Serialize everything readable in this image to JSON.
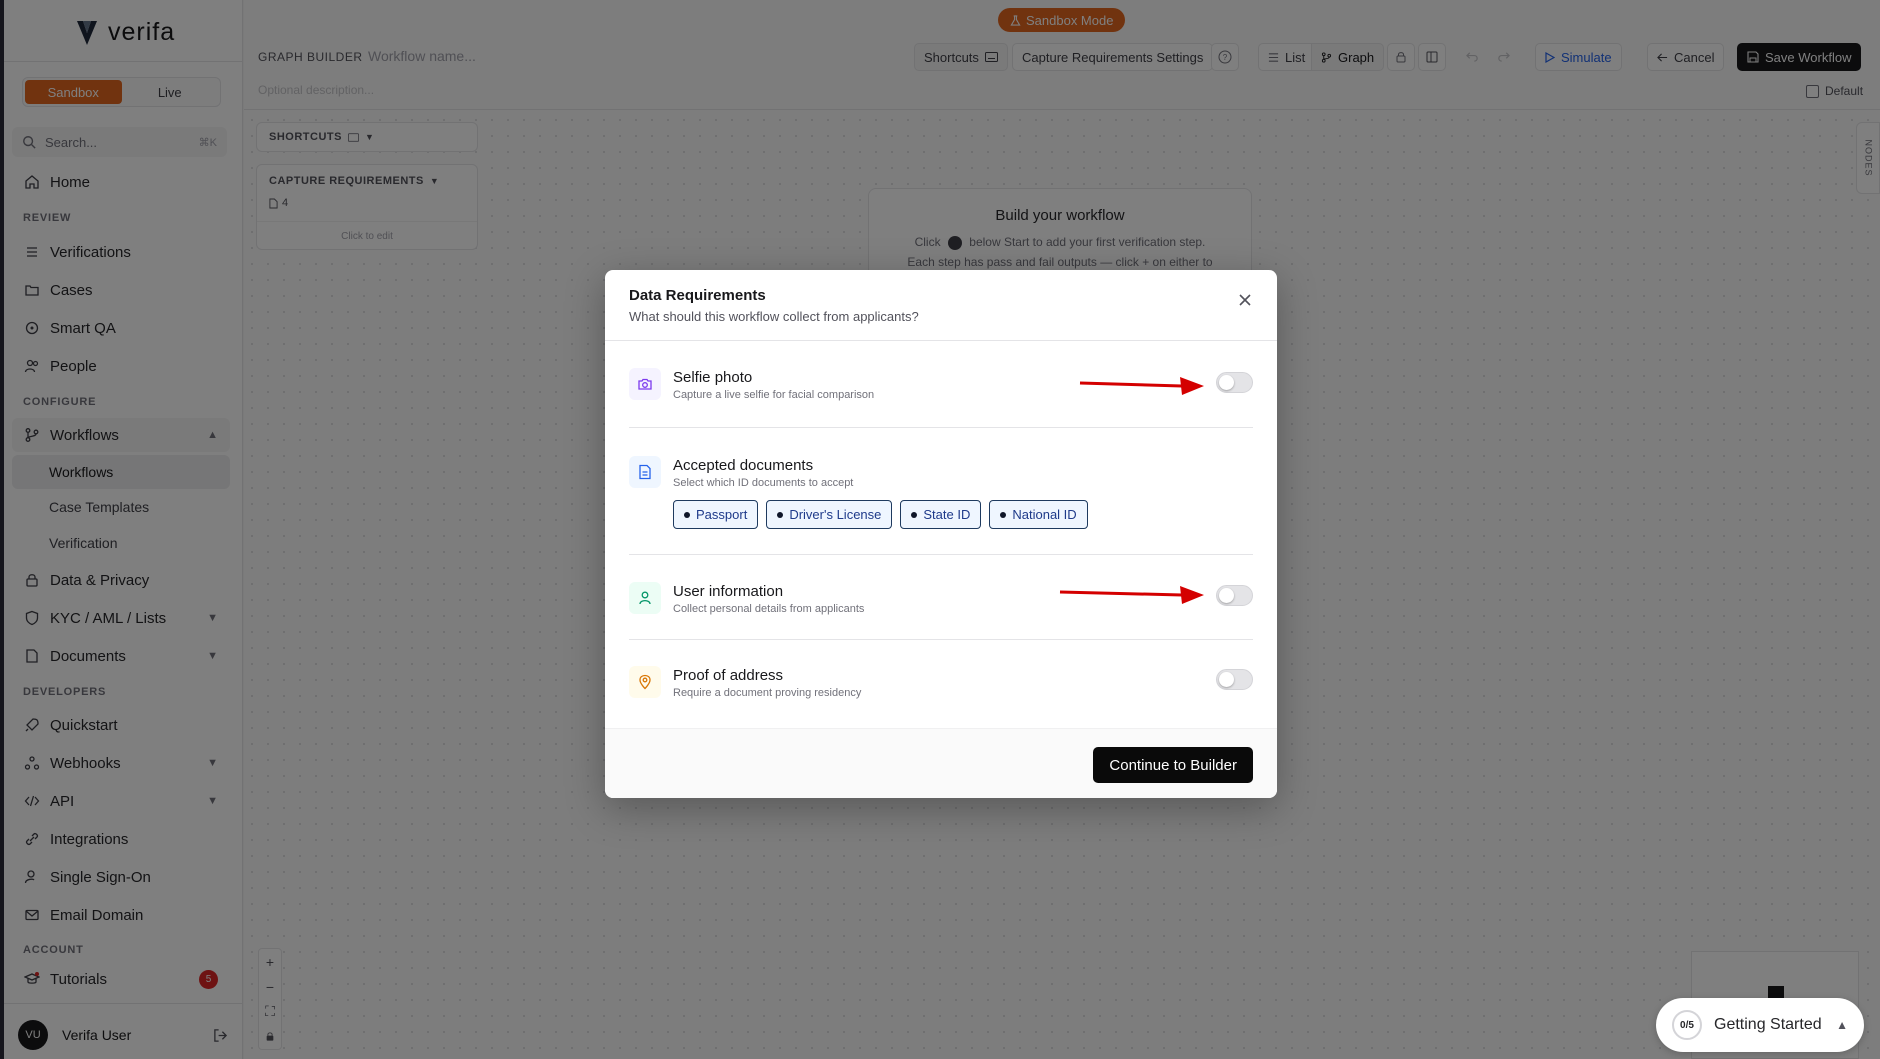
{
  "brand": {
    "name": "verifa"
  },
  "env": {
    "sandbox": "Sandbox",
    "live": "Live"
  },
  "search": {
    "placeholder": "Search...",
    "shortcut": "⌘K"
  },
  "nav": {
    "home": "Home",
    "review_label": "REVIEW",
    "verifications": "Verifications",
    "cases": "Cases",
    "smart_qa": "Smart QA",
    "people": "People",
    "configure_label": "CONFIGURE",
    "workflows": "Workflows",
    "workflows_sub": "Workflows",
    "case_templates": "Case Templates",
    "verification": "Verification",
    "data_privacy": "Data & Privacy",
    "kyc": "KYC / AML / Lists",
    "documents": "Documents",
    "developers_label": "DEVELOPERS",
    "quickstart": "Quickstart",
    "webhooks": "Webhooks",
    "api": "API",
    "integrations": "Integrations",
    "sso": "Single Sign-On",
    "email_domain": "Email Domain",
    "account_label": "ACCOUNT",
    "tutorials": "Tutorials",
    "tutorials_count": "5"
  },
  "user": {
    "initials": "VU",
    "name": "Verifa User"
  },
  "topbar": {
    "sandbox_mode": "Sandbox Mode",
    "graph_builder": "GRAPH BUILDER",
    "workflow_name_placeholder": "Workflow name...",
    "description_placeholder": "Optional description...",
    "shortcuts": "Shortcuts",
    "capture_settings": "Capture Requirements Settings",
    "list": "List",
    "graph": "Graph",
    "simulate": "Simulate",
    "cancel": "Cancel",
    "save": "Save Workflow",
    "default": "Default"
  },
  "canvas": {
    "shortcuts_panel": "SHORTCUTS",
    "capture_panel": "CAPTURE REQUIREMENTS",
    "capture_count": "4",
    "click_to_edit": "Click to edit",
    "build_title": "Build your workflow",
    "build_line1_a": "Click",
    "build_line1_b": "below Start to add your first verification step.",
    "build_line2": "Each step has pass and fail outputs — click + on either to",
    "nodes_tab": "NODES"
  },
  "getting_started": {
    "progress": "0/5",
    "label": "Getting Started"
  },
  "modal": {
    "title": "Data Requirements",
    "subtitle": "What should this workflow collect from applicants?",
    "selfie": {
      "title": "Selfie photo",
      "desc": "Capture a live selfie for facial comparison",
      "enabled": false
    },
    "documents": {
      "title": "Accepted documents",
      "desc": "Select which ID documents to accept",
      "chips": [
        "Passport",
        "Driver's License",
        "State ID",
        "National ID"
      ]
    },
    "user_info": {
      "title": "User information",
      "desc": "Collect personal details from applicants",
      "enabled": false
    },
    "address": {
      "title": "Proof of address",
      "desc": "Require a document proving residency",
      "enabled": false
    },
    "continue": "Continue to Builder"
  },
  "colors": {
    "accent": "#e2661f",
    "annotation_arrow": "#d40000"
  }
}
